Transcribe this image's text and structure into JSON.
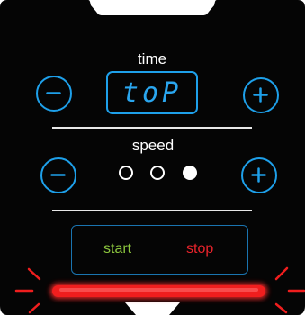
{
  "time_section": {
    "label": "time",
    "display": "toP"
  },
  "speed_section": {
    "label": "speed",
    "level": 3,
    "max_level": 3
  },
  "controls": {
    "start_label": "start",
    "stop_label": "stop"
  },
  "colors": {
    "panel": "#050505",
    "accent_blue": "#1ea0ea",
    "start_green": "#8cc63e",
    "stop_red": "#e8232b",
    "alert_bar": "#f01e1e"
  },
  "icons": {
    "minus": "minus-icon",
    "plus": "plus-icon"
  }
}
